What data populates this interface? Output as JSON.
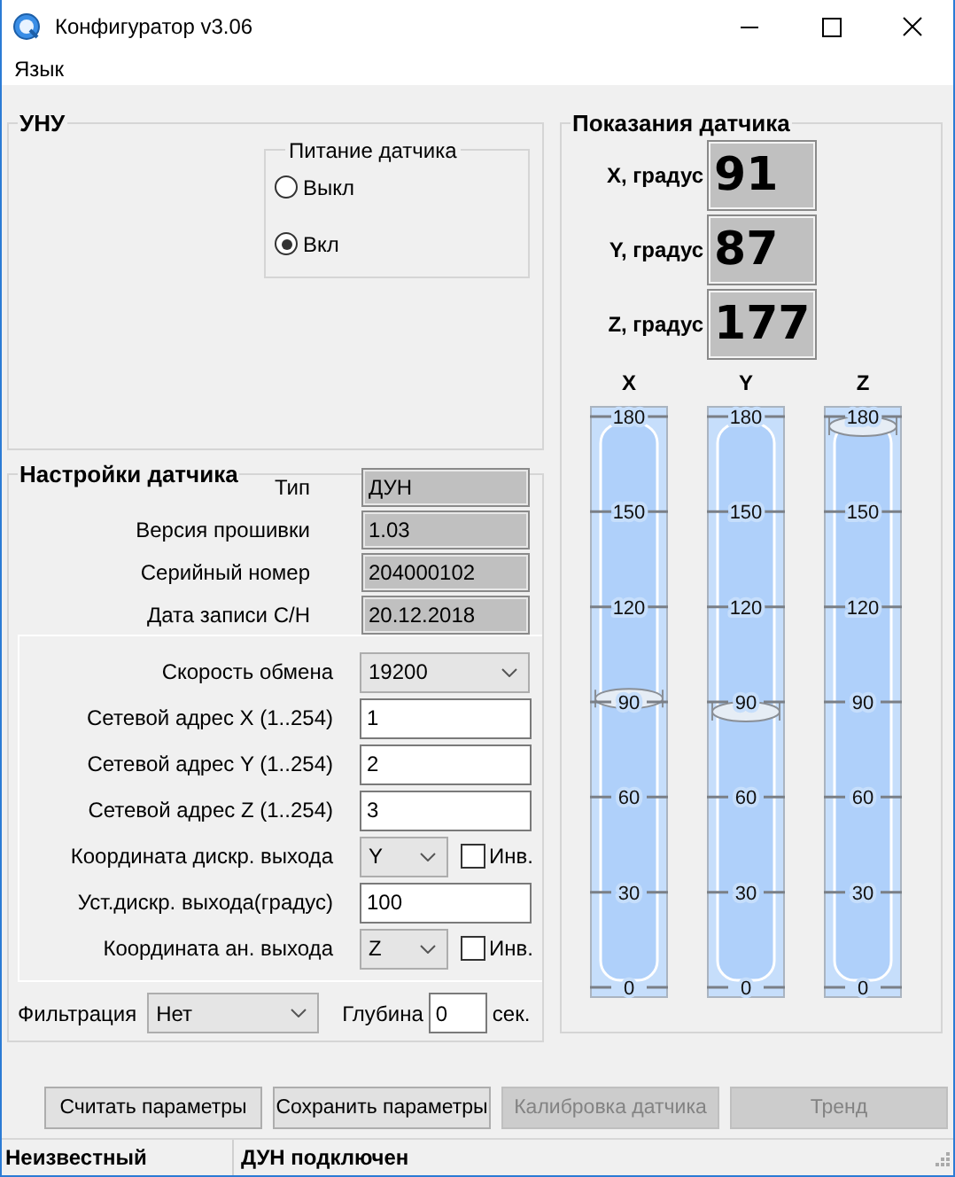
{
  "window": {
    "title": "Конфигуратор v3.06"
  },
  "menu": [
    {
      "label": "Язык"
    }
  ],
  "uny": {
    "title": "УНУ",
    "power": {
      "title": "Питание датчика",
      "options": [
        {
          "label": "Выкл",
          "selected": false
        },
        {
          "label": "Вкл",
          "selected": true
        }
      ]
    }
  },
  "settings": {
    "title": "Настройки датчика",
    "info": [
      {
        "label": "Тип",
        "value": "ДУН"
      },
      {
        "label": "Версия прошивки",
        "value": "1.03"
      },
      {
        "label": "Серийный номер",
        "value": "204000102"
      },
      {
        "label": "Дата записи С/Н",
        "value": "20.12.2018"
      }
    ],
    "params": [
      {
        "kind": "combo",
        "label": "Скорость обмена",
        "value": "19200"
      },
      {
        "kind": "input",
        "label": "Сетевой адрес X (1..254)",
        "value": "1"
      },
      {
        "kind": "input",
        "label": "Сетевой адрес Y (1..254)",
        "value": "2"
      },
      {
        "kind": "input",
        "label": "Сетевой адрес Z (1..254)",
        "value": "3"
      },
      {
        "kind": "combo_check",
        "label": "Координата дискр. выхода",
        "value": "Y",
        "check": {
          "label": "Инв.",
          "checked": false
        }
      },
      {
        "kind": "input",
        "label": "Уст.дискр. выхода(градус)",
        "value": "100"
      },
      {
        "kind": "combo_check",
        "label": "Координата ан. выхода",
        "value": "Z",
        "check": {
          "label": "Инв.",
          "checked": false
        }
      }
    ],
    "filter": {
      "label": "Фильтрация",
      "value": "Нет",
      "depth_label": "Глубина",
      "depth": "0",
      "unit": "сек."
    }
  },
  "readings": {
    "title": "Показания датчика",
    "values": [
      {
        "label": "X, градус",
        "value": "91"
      },
      {
        "label": "Y, градус",
        "value": "87"
      },
      {
        "label": "Z, градус",
        "value": "177"
      }
    ],
    "gauges": [
      {
        "axis": "X",
        "level": 0.506,
        "ticks": [
          "180",
          "150",
          "120",
          "90",
          "60",
          "30",
          "0"
        ]
      },
      {
        "axis": "Y",
        "level": 0.483,
        "ticks": [
          "180",
          "150",
          "120",
          "90",
          "60",
          "30",
          "0"
        ]
      },
      {
        "axis": "Z",
        "level": 0.983,
        "ticks": [
          "180",
          "150",
          "120",
          "90",
          "60",
          "30",
          "0"
        ]
      }
    ]
  },
  "buttons": [
    {
      "label": "Считать параметры",
      "disabled": false
    },
    {
      "label": "Сохранить параметры",
      "disabled": false
    },
    {
      "label": "Калибровка датчика",
      "disabled": true
    },
    {
      "label": "Тренд",
      "disabled": true
    }
  ],
  "status_bar": [
    "Неизвестный",
    "ДУН подключен"
  ]
}
